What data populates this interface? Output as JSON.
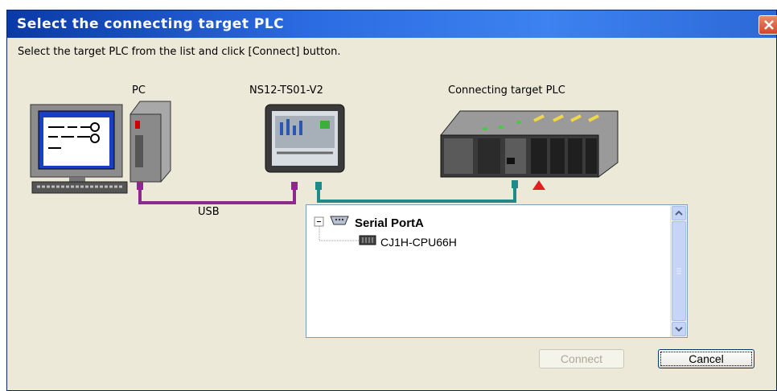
{
  "window": {
    "title": "Select the connecting target PLC"
  },
  "instruction": "Select the target PLC from the list and click [Connect] button.",
  "diagram": {
    "pc_label": "PC",
    "terminal_label": "NS12-TS01-V2",
    "plc_label": "Connecting target PLC",
    "usb_label": "USB",
    "colors": {
      "usb_link": "#8b2a8a",
      "serial_link": "#1e8a8a",
      "marker": "#e02020"
    }
  },
  "tree": {
    "nodes": [
      {
        "label": "Serial PortA",
        "expanded": true,
        "icon": "serial-port-icon"
      },
      {
        "label": "CJ1H-CPU66H",
        "icon": "plc-unit-icon"
      }
    ],
    "expand_glyph": "−"
  },
  "buttons": {
    "connect": "Connect",
    "cancel": "Cancel"
  }
}
